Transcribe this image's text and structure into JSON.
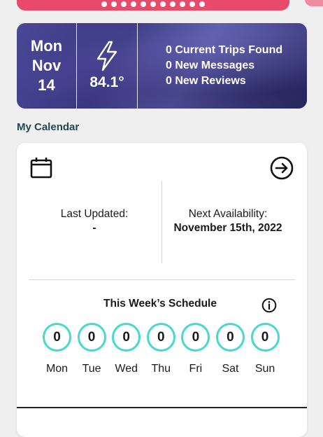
{
  "header": {
    "carousel_dots": 11
  },
  "banner": {
    "weekday": "Mon",
    "month": "Nov",
    "day": "14",
    "temperature": "84.1°",
    "weather_icon": "lightning-icon",
    "stats": [
      "0 Current Trips Found",
      "0 New Messages",
      "0 New Reviews"
    ]
  },
  "calendar": {
    "section_title": "My Calendar",
    "last_updated_label": "Last Updated:",
    "last_updated_value": "-",
    "next_availability_label": "Next Availability:",
    "next_availability_value": "November 15th, 2022",
    "schedule_title": "This Week’s Schedule",
    "days": [
      {
        "label": "Mon",
        "count": "0"
      },
      {
        "label": "Tue",
        "count": "0"
      },
      {
        "label": "Wed",
        "count": "0"
      },
      {
        "label": "Thu",
        "count": "0"
      },
      {
        "label": "Fri",
        "count": "0"
      },
      {
        "label": "Sat",
        "count": "0"
      },
      {
        "label": "Sun",
        "count": "0"
      }
    ]
  },
  "colors": {
    "accent_pink": "#e94a6a",
    "day_ring": "#49d8cf",
    "section_title": "#1f4a4f"
  }
}
